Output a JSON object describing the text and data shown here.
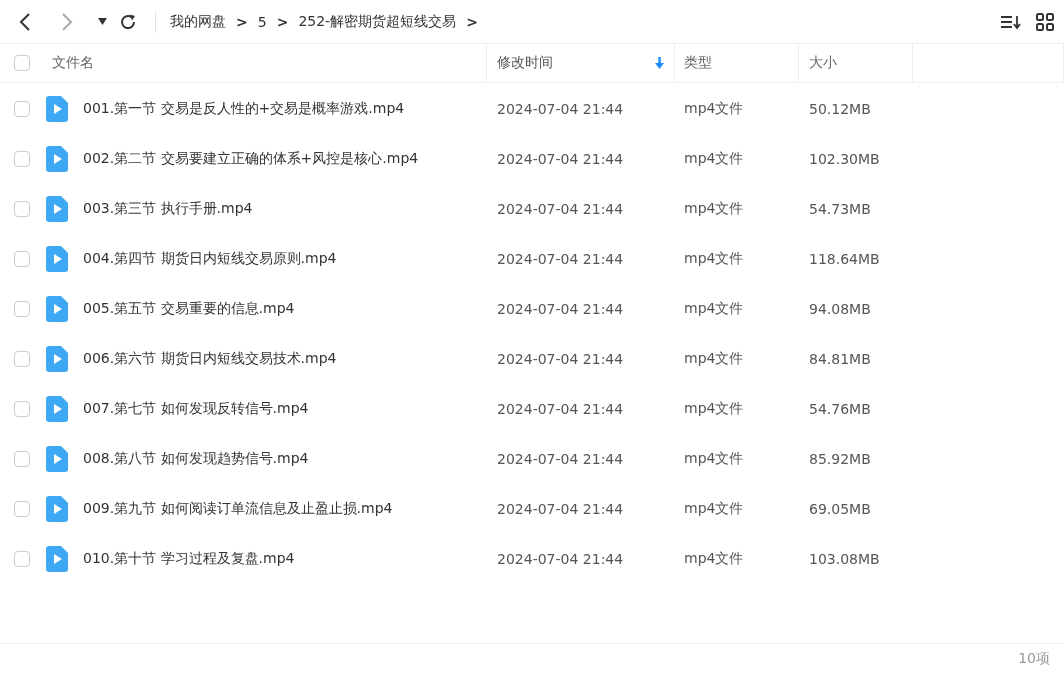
{
  "breadcrumb": [
    {
      "label": "我的网盘"
    },
    {
      "label": "5"
    },
    {
      "label": "252-解密期货超短线交易"
    }
  ],
  "breadcrumb_separator": ">",
  "table": {
    "columns": [
      {
        "label": "文件名",
        "sorted": false
      },
      {
        "label": "修改时间",
        "sorted": true
      },
      {
        "label": "类型",
        "sorted": false
      },
      {
        "label": "大小",
        "sorted": false
      }
    ],
    "select_all_checked": false,
    "rows": [
      {
        "name": "001.第一节 交易是反人性的+交易是概率游戏.mp4",
        "modified": "2024-07-04 21:44",
        "type": "mp4文件",
        "size": "50.12MB",
        "checked": false
      },
      {
        "name": "002.第二节 交易要建立正确的体系+风控是核心.mp4",
        "modified": "2024-07-04 21:44",
        "type": "mp4文件",
        "size": "102.30MB",
        "checked": false
      },
      {
        "name": "003.第三节 执行手册.mp4",
        "modified": "2024-07-04 21:44",
        "type": "mp4文件",
        "size": "54.73MB",
        "checked": false
      },
      {
        "name": "004.第四节 期货日内短线交易原则.mp4",
        "modified": "2024-07-04 21:44",
        "type": "mp4文件",
        "size": "118.64MB",
        "checked": false
      },
      {
        "name": "005.第五节 交易重要的信息.mp4",
        "modified": "2024-07-04 21:44",
        "type": "mp4文件",
        "size": "94.08MB",
        "checked": false
      },
      {
        "name": "006.第六节 期货日内短线交易技术.mp4",
        "modified": "2024-07-04 21:44",
        "type": "mp4文件",
        "size": "84.81MB",
        "checked": false
      },
      {
        "name": "007.第七节 如何发现反转信号.mp4",
        "modified": "2024-07-04 21:44",
        "type": "mp4文件",
        "size": "54.76MB",
        "checked": false
      },
      {
        "name": "008.第八节 如何发现趋势信号.mp4",
        "modified": "2024-07-04 21:44",
        "type": "mp4文件",
        "size": "85.92MB",
        "checked": false
      },
      {
        "name": "009.第九节 如何阅读订单流信息及止盈止损.mp4",
        "modified": "2024-07-04 21:44",
        "type": "mp4文件",
        "size": "69.05MB",
        "checked": false
      },
      {
        "name": "010.第十节 学习过程及复盘.mp4",
        "modified": "2024-07-04 21:44",
        "type": "mp4文件",
        "size": "103.08MB",
        "checked": false
      }
    ]
  },
  "status_bar": {
    "count": "10项"
  }
}
